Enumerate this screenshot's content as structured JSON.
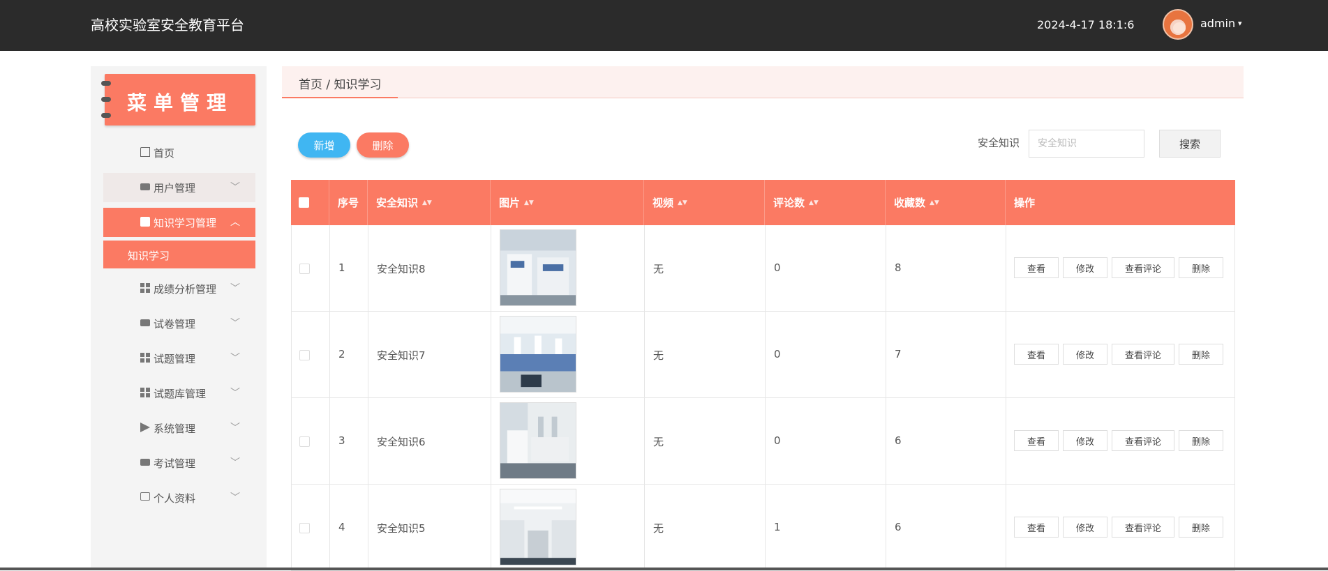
{
  "header": {
    "title": "高校实验室安全教育平台",
    "datetime": "2024-4-17 18:1:6",
    "user": "admin",
    "caret": "▾"
  },
  "sidebar": {
    "banner": "菜单管理",
    "items": [
      {
        "label": "首页",
        "icon": "home-icon"
      },
      {
        "label": "用户管理",
        "icon": "users-icon",
        "chevron": "﹀"
      },
      {
        "label": "知识学习管理",
        "icon": "clipboard-icon",
        "chevron": "︿"
      },
      {
        "label": "成绩分析管理",
        "icon": "grid-icon",
        "chevron": "﹀"
      },
      {
        "label": "试卷管理",
        "icon": "monitor-icon",
        "chevron": "﹀"
      },
      {
        "label": "试题管理",
        "icon": "grid-icon",
        "chevron": "﹀"
      },
      {
        "label": "试题库管理",
        "icon": "grid-icon",
        "chevron": "﹀"
      },
      {
        "label": "系统管理",
        "icon": "send-icon",
        "chevron": "﹀"
      },
      {
        "label": "考试管理",
        "icon": "monitor-icon",
        "chevron": "﹀"
      },
      {
        "label": "个人资料",
        "icon": "card-icon",
        "chevron": "﹀"
      }
    ],
    "sub_item": "知识学习"
  },
  "breadcrumb": "首页 / 知识学习",
  "toolbar": {
    "add": "新增",
    "delete": "删除",
    "search_label": "安全知识",
    "search_placeholder": "安全知识",
    "search_button": "搜索"
  },
  "table": {
    "headers": [
      "序号",
      "安全知识",
      "图片",
      "视频",
      "评论数",
      "收藏数",
      "操作"
    ],
    "sort_glyph": "▲▼",
    "ops": [
      "查看",
      "修改",
      "查看评论",
      "删除"
    ],
    "rows": [
      {
        "index": "1",
        "name": "安全知识8",
        "video": "无",
        "comments": "0",
        "favorites": "8"
      },
      {
        "index": "2",
        "name": "安全知识7",
        "video": "无",
        "comments": "0",
        "favorites": "7"
      },
      {
        "index": "3",
        "name": "安全知识6",
        "video": "无",
        "comments": "0",
        "favorites": "6"
      },
      {
        "index": "4",
        "name": "安全知识5",
        "video": "无",
        "comments": "1",
        "favorites": "6"
      }
    ]
  },
  "colors": {
    "accent": "#fb7a63",
    "blue": "#40b6f2",
    "header_bg": "#2b2b2b"
  }
}
